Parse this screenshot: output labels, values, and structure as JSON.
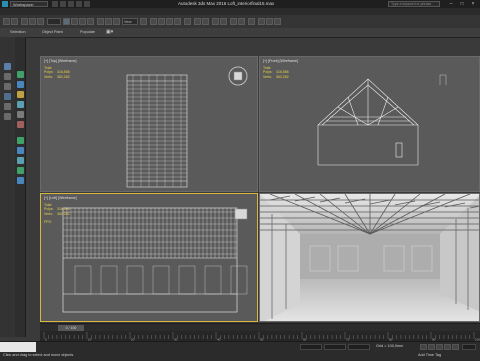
{
  "app": {
    "title": "Autodesk 3ds Max 2016    Loft_interiorfinal15.max",
    "workspace": "Workspace: Default",
    "search_placeholder": "Type a keyword or phrase"
  },
  "menu": [
    "",
    "",
    "",
    "",
    "",
    "",
    "",
    "",
    "",
    "",
    "",
    "",
    "",
    ""
  ],
  "toolbar": {
    "view_select": "View"
  },
  "ribbon": {
    "tabs": [
      "Selection",
      "Object Paint",
      "Populate"
    ]
  },
  "viewports": {
    "top": {
      "label": "[+] [Top] [Wireframe]",
      "stats": {
        "header": "Total",
        "polys_label": "Polys:",
        "polys": "316,586",
        "verts_label": "Verts:",
        "verts": "362,282"
      }
    },
    "front": {
      "label": "[+] [Front] [Wireframe]",
      "stats": {
        "header": "Total",
        "polys_label": "Polys:",
        "polys": "316,586",
        "verts_label": "Verts:",
        "verts": "362,282"
      }
    },
    "left": {
      "label": "[+] [Left] [Wireframe]",
      "stats": {
        "header": "Total",
        "polys_label": "Polys:",
        "polys": "316,586",
        "verts_label": "Verts:",
        "verts": "362,282",
        "fps_label": "FPS:",
        "fps": ""
      }
    },
    "persp": {
      "label": ""
    }
  },
  "timeline": {
    "frame": "0 / 100",
    "ticks": [
      "0",
      "10",
      "20",
      "30",
      "40",
      "50",
      "60",
      "70",
      "80",
      "90",
      "100"
    ]
  },
  "status": {
    "message": "Click and drag to select and move objects",
    "grid": "Grid = 100,0mm",
    "add_time_tag": "Add Time Tag"
  },
  "colors": {
    "active_border": "#d9b640",
    "stats_text": "#e8d24a",
    "viewport_bg": "#5a5a5a"
  }
}
